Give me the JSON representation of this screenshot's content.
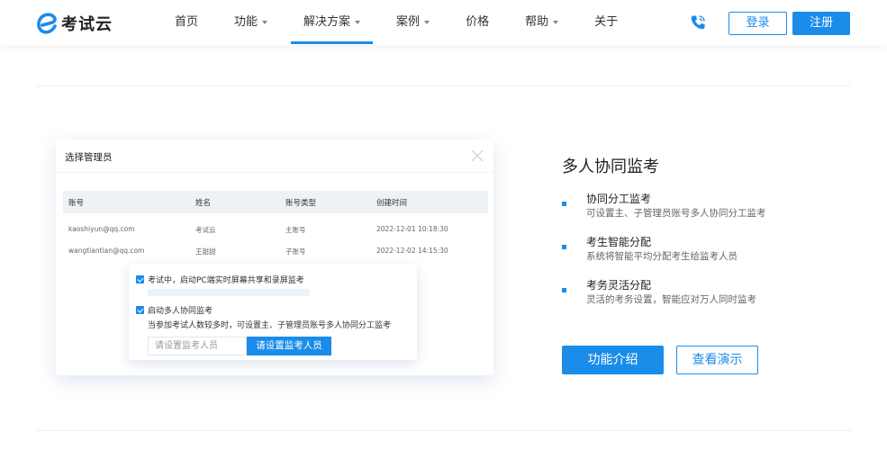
{
  "header": {
    "logo_text": "考试云",
    "nav": [
      {
        "label": "首页",
        "has_caret": false,
        "active": false
      },
      {
        "label": "功能",
        "has_caret": true,
        "active": false
      },
      {
        "label": "解决方案",
        "has_caret": true,
        "active": true
      },
      {
        "label": "案例",
        "has_caret": true,
        "active": false
      },
      {
        "label": "价格",
        "has_caret": false,
        "active": false
      },
      {
        "label": "帮助",
        "has_caret": true,
        "active": false
      },
      {
        "label": "关于",
        "has_caret": false,
        "active": false
      }
    ],
    "phone_icon": "phone-icon",
    "login_label": "登录",
    "register_label": "注册"
  },
  "illustration": {
    "dialog_title": "选择管理员",
    "columns": [
      "账号",
      "姓名",
      "账号类型",
      "创建时间"
    ],
    "rows": [
      [
        "kaoshiyun@qq.com",
        "考试云",
        "主账号",
        "2022-12-01 10:18:30"
      ],
      [
        "wangtiantian@qq.com",
        "王甜甜",
        "子账号",
        "2022-12-02 14:15:30"
      ]
    ],
    "popup": {
      "option1": "考试中，启动PC端实时屏幕共享和录屏监考",
      "option2": "启动多人协同监考",
      "option2_desc": "当参加考试人数较多时，可设置主、子管理员账号多人协同分工监考",
      "input_placeholder": "请设置监考人员",
      "button_label": "请设置监考人员"
    }
  },
  "feature": {
    "title": "多人协同监考",
    "items": [
      {
        "name": "协同分工监考",
        "desc": "可设置主、子管理员账号多人协同分工监考"
      },
      {
        "name": "考生智能分配",
        "desc": "系统将智能平均分配考生给监考人员"
      },
      {
        "name": "考务灵活分配",
        "desc": "灵活的考务设置，智能应对万人同时监考"
      }
    ],
    "intro_button": "功能介绍",
    "demo_button": "查看演示"
  },
  "colors": {
    "accent": "#1a8cea"
  }
}
